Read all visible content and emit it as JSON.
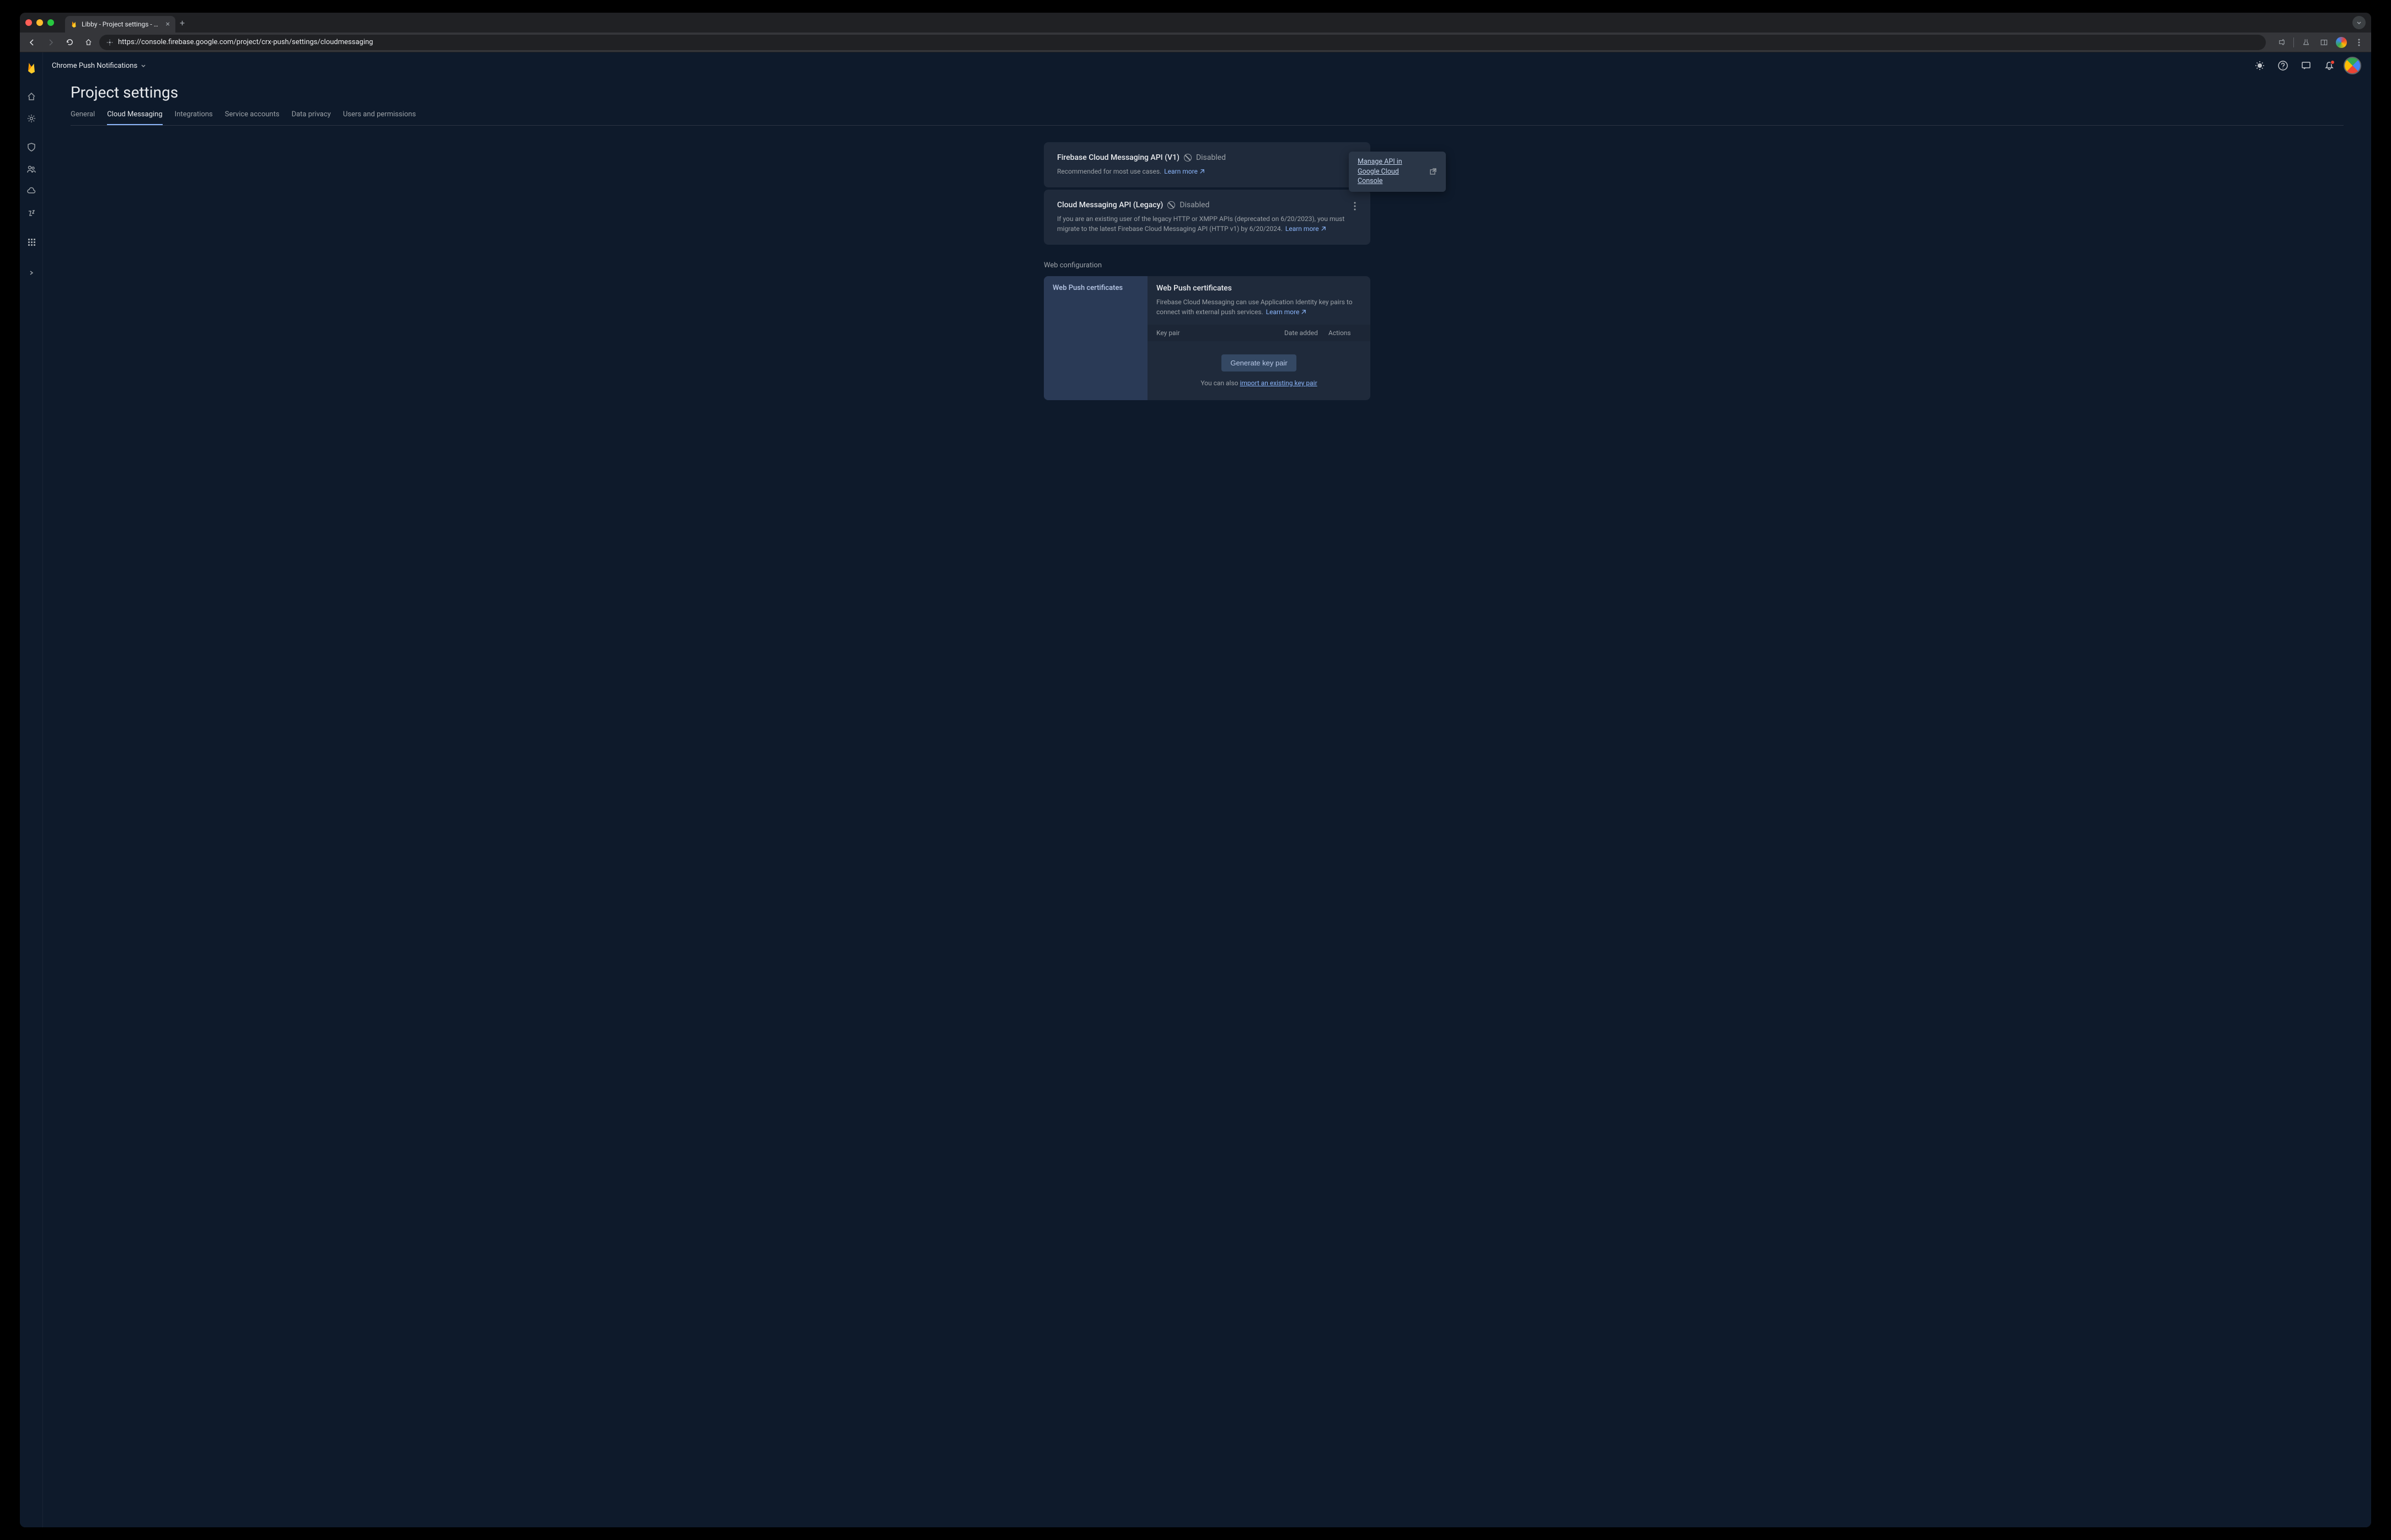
{
  "browser": {
    "tab_title": "Libby - Project settings - Fire",
    "url": "https://console.firebase.google.com/project/crx-push/settings/cloudmessaging"
  },
  "project": {
    "name": "Chrome Push Notifications"
  },
  "page": {
    "title": "Project settings"
  },
  "tabs": {
    "general": "General",
    "cloud_messaging": "Cloud Messaging",
    "integrations": "Integrations",
    "service_accounts": "Service accounts",
    "data_privacy": "Data privacy",
    "users_permissions": "Users and permissions"
  },
  "card_v1": {
    "title": "Firebase Cloud Messaging API (V1)",
    "status": "Disabled",
    "desc": "Recommended for most use cases.",
    "learn_more": "Learn more"
  },
  "popover": {
    "text": "Manage API in Google Cloud Console"
  },
  "card_legacy": {
    "title": "Cloud Messaging API (Legacy)",
    "status": "Disabled",
    "desc": "If you are an existing user of the legacy HTTP or XMPP APIs (deprecated on 6/20/2023), you must migrate to the latest Firebase Cloud Messaging API (HTTP v1) by 6/20/2024.",
    "learn_more": "Learn more"
  },
  "web_config": {
    "heading": "Web configuration",
    "left_tab": "Web Push certificates",
    "title": "Web Push certificates",
    "desc": "Firebase Cloud Messaging can use Application Identity key pairs to connect with external push services.",
    "learn_more": "Learn more",
    "col_keypair": "Key pair",
    "col_date": "Date added",
    "col_actions": "Actions",
    "generate_btn": "Generate key pair",
    "import_prefix": "You can also ",
    "import_link": "import an existing key pair"
  }
}
